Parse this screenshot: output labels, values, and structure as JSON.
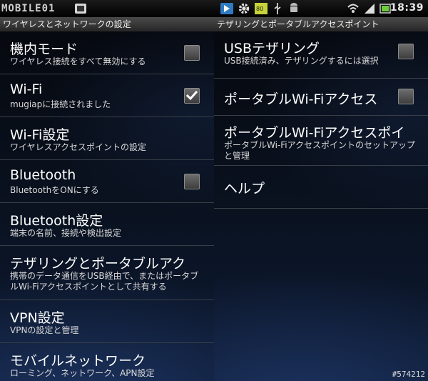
{
  "status": {
    "brand": "MOBILE01",
    "time": "18:39",
    "icons": [
      "notify-icon",
      "gear-icon",
      "battery-80-icon",
      "usb-icon",
      "android-icon",
      "wifi-icon",
      "signal-icon",
      "battery-icon"
    ]
  },
  "left": {
    "header": "ワイヤレスとネットワークの設定",
    "items": [
      {
        "title": "機内モード",
        "summary": "ワイヤレス接続をすべて無効にする",
        "checkbox": true,
        "checked": false
      },
      {
        "title": "Wi-Fi",
        "summary": "mugiapに接続されました",
        "checkbox": true,
        "checked": true
      },
      {
        "title": "Wi-Fi設定",
        "summary": "ワイヤレスアクセスポイントの設定",
        "checkbox": false
      },
      {
        "title": "Bluetooth",
        "summary": "BluetoothをONにする",
        "checkbox": true,
        "checked": false
      },
      {
        "title": "Bluetooth設定",
        "summary": "端末の名前、接続や検出設定",
        "checkbox": false
      },
      {
        "title": "テザリングとポータブルアク",
        "summary": "携帯のデータ通信をUSB経由で、またはポータブルWi-Fiアクセスポイントとして共有する",
        "checkbox": false
      },
      {
        "title": "VPN設定",
        "summary": "VPNの設定と管理",
        "checkbox": false
      },
      {
        "title": "モバイルネットワーク",
        "summary": "ローミング、ネットワーク、APN設定",
        "checkbox": false
      }
    ]
  },
  "right": {
    "header": "テザリングとポータブルアクセスポイント",
    "items": [
      {
        "title": "USBテザリング",
        "summary": "USB接続済み、テザリングするには選択",
        "checkbox": true,
        "checked": false
      },
      {
        "title": "ポータブルWi-Fiアクセス",
        "summary": "",
        "checkbox": true,
        "checked": false
      },
      {
        "title": "ポータブルWi-Fiアクセスポイ",
        "summary": "ポータブルWi-Fiアクセスポイントのセットアップと管理",
        "checkbox": false
      },
      {
        "title": "ヘルプ",
        "summary": "",
        "checkbox": false
      }
    ]
  },
  "watermark": "#574212"
}
